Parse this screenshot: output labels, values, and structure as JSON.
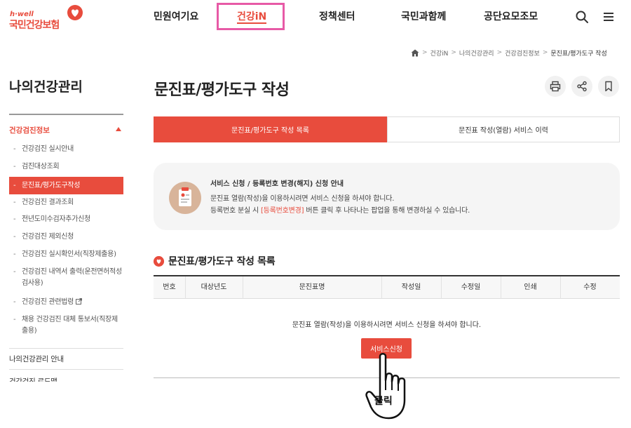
{
  "header": {
    "logo_small": "h·well",
    "logo_text": "국민건강보험",
    "nav": [
      "민원여기요",
      "건강iN",
      "정책센터",
      "국민과함께",
      "공단요모조모"
    ],
    "active_nav_index": 1,
    "search_icon": "search-icon",
    "menu_icon": "hamburger-menu-icon"
  },
  "breadcrumb": {
    "home_icon": "home-icon",
    "items": [
      "건강iN",
      "나의건강관리",
      "건강검진정보",
      "문진표/평가도구 작성"
    ]
  },
  "sidebar": {
    "title": "나의건강관리",
    "section": "건강검진정보",
    "items": [
      "건강검진 실시안내",
      "검진대상조회",
      "문진표/평가도구작성",
      "건강검진 결과조회",
      "전년도미수검자추가신청",
      "건강검진 제외신청",
      "건강검진 실시확인서(직장제출용)",
      "건강검진 내역서 출력(운전면허적성검사용)",
      "건강검진 관련법령",
      "채용 건강검진 대체 통보서(직장제출용)"
    ],
    "active_index": 2,
    "bottom_items": [
      "나의건강관리 안내",
      "건강검진 로드맵"
    ]
  },
  "main": {
    "title": "문진표/평가도구 작성",
    "actions": [
      "print-icon",
      "share-icon",
      "bookmark-icon"
    ],
    "tabs": [
      "문진표/평가도구 작성 목록",
      "문진표 작성(열람) 서비스 이력"
    ],
    "active_tab": 0,
    "info": {
      "title": "서비스 신청 / 등록번호 변경(해지) 신청 안내",
      "line1": "문진표 열람(작성)을 이용하시려면 서비스 신청을 하셔야 합니다.",
      "line2_prefix": "등록번호 분실 시 ",
      "line2_highlight": "[등록번호변경]",
      "line2_suffix": " 버튼 클릭 후 나타나는 팝업을 통해 변경하실 수 있습니다."
    },
    "list_title": "문진표/평가도구 작성 목록",
    "columns": [
      "번호",
      "대상년도",
      "문진표명",
      "작성일",
      "수정일",
      "인쇄",
      "수정"
    ],
    "empty_message": "문진표 열람(작성)을 이용하시려면 서비스 신청을 하셔야 합니다.",
    "apply_button": "서비스신청",
    "click_label": "클릭"
  },
  "colors": {
    "accent": "#e84c3d",
    "highlight_box": "#e75aa6"
  }
}
